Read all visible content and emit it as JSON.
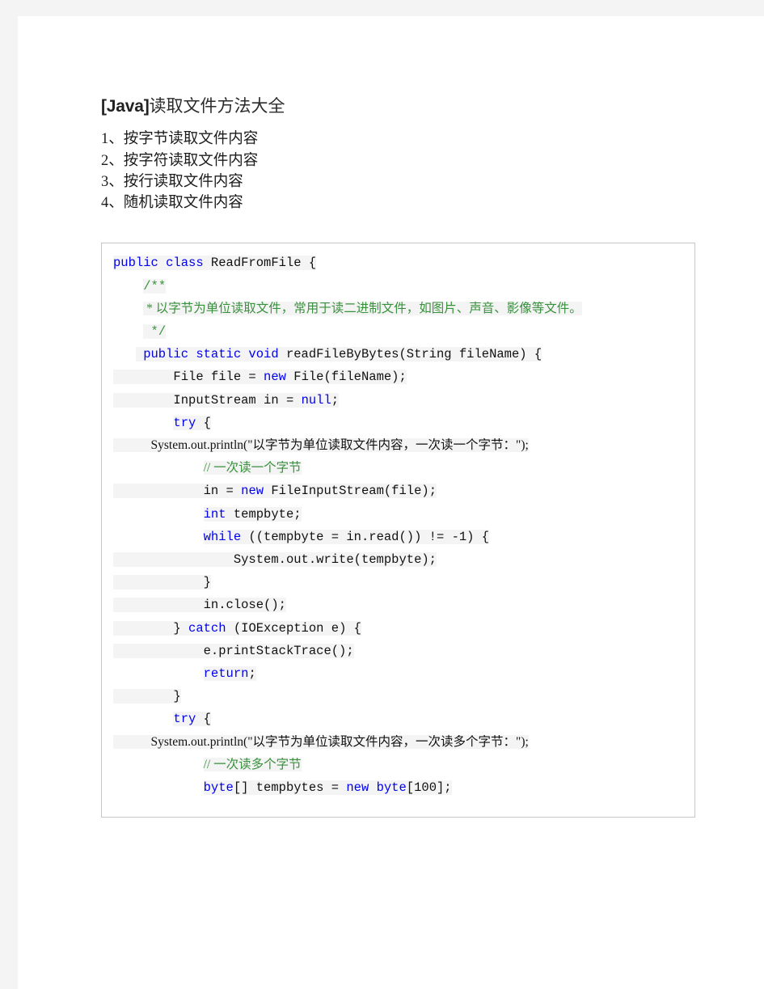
{
  "document": {
    "title": {
      "latin": "[Java]",
      "cjk": "读取文件方法大全"
    },
    "intro_items": [
      "1、按字节读取文件内容",
      "2、按字符读取文件内容",
      "3、按行读取文件内容",
      "4、随机读取文件内容"
    ]
  },
  "colors": {
    "page_background": "#f4f4f4",
    "sheet": "#ffffff",
    "code_border": "#c6c6c6",
    "code_highlight": "#f4f4f4",
    "keyword": "#0000ee",
    "comment": "#38913c",
    "plain": "#111111",
    "title": "#2b2b2b"
  },
  "code_block": {
    "language": "java",
    "lines": [
      [
        {
          "t": "public class ",
          "c": "kw"
        },
        {
          "t": "ReadFromFile {",
          "c": "txt"
        }
      ],
      [
        {
          "t": "    ",
          "c": "plain"
        },
        {
          "t": "/**",
          "c": "cmt"
        }
      ],
      [
        {
          "t": "    ",
          "c": "plain"
        },
        {
          "t": " * 以字节为单位读取文件，常用于读二进制文件，如图片、声音、影像等文件。",
          "c": "cmt"
        }
      ],
      [
        {
          "t": "    ",
          "c": "plain"
        },
        {
          "t": " */",
          "c": "cmt"
        }
      ],
      [
        {
          "t": "   ",
          "c": "plain"
        },
        {
          "t": " public static void ",
          "c": "kw"
        },
        {
          "t": "readFileByBytes(String fileName) {",
          "c": "txt"
        }
      ],
      [
        {
          "t": "        File file = ",
          "c": "txt"
        },
        {
          "t": "new ",
          "c": "kw"
        },
        {
          "t": "File(fileName);",
          "c": "txt"
        }
      ],
      [
        {
          "t": "        InputStream in = ",
          "c": "txt"
        },
        {
          "t": "null",
          "c": "kw"
        },
        {
          "t": ";",
          "c": "txt"
        }
      ],
      [
        {
          "t": "        ",
          "c": "plain"
        },
        {
          "t": "try ",
          "c": "kw"
        },
        {
          "t": "{",
          "c": "txt"
        }
      ],
      [
        {
          "t": "            System.out.println(\"以字节为单位读取文件内容，一次读一个字节：\");",
          "c": "txt"
        }
      ],
      [
        {
          "t": "            ",
          "c": "plain"
        },
        {
          "t": "// 一次读一个字节",
          "c": "cmt"
        }
      ],
      [
        {
          "t": "            in = ",
          "c": "txt"
        },
        {
          "t": "new ",
          "c": "kw"
        },
        {
          "t": "FileInputStream(file);",
          "c": "txt"
        }
      ],
      [
        {
          "t": "            ",
          "c": "plain"
        },
        {
          "t": "int ",
          "c": "kw"
        },
        {
          "t": "tempbyte;",
          "c": "txt"
        }
      ],
      [
        {
          "t": "            ",
          "c": "plain"
        },
        {
          "t": "while ",
          "c": "kw"
        },
        {
          "t": "((tempbyte = in.read()) != -1) {",
          "c": "txt"
        }
      ],
      [
        {
          "t": "                System.out.write(tempbyte);",
          "c": "txt"
        }
      ],
      [
        {
          "t": "            }",
          "c": "txt"
        }
      ],
      [
        {
          "t": "            in.close();",
          "c": "txt"
        }
      ],
      [
        {
          "t": "        } ",
          "c": "txt"
        },
        {
          "t": "catch ",
          "c": "kw"
        },
        {
          "t": "(IOException e) {",
          "c": "txt"
        }
      ],
      [
        {
          "t": "            e.printStackTrace();",
          "c": "txt"
        }
      ],
      [
        {
          "t": "            ",
          "c": "plain"
        },
        {
          "t": "return",
          "c": "kw"
        },
        {
          "t": ";",
          "c": "txt"
        }
      ],
      [
        {
          "t": "        }",
          "c": "txt"
        }
      ],
      [
        {
          "t": "        ",
          "c": "plain"
        },
        {
          "t": "try ",
          "c": "kw"
        },
        {
          "t": "{",
          "c": "txt"
        }
      ],
      [
        {
          "t": "            System.out.println(\"以字节为单位读取文件内容，一次读多个字节：\");",
          "c": "txt"
        }
      ],
      [
        {
          "t": "            ",
          "c": "plain"
        },
        {
          "t": "// 一次读多个字节",
          "c": "cmt"
        }
      ],
      [
        {
          "t": "            ",
          "c": "plain"
        },
        {
          "t": "byte",
          "c": "kw"
        },
        {
          "t": "[] tempbytes = ",
          "c": "txt"
        },
        {
          "t": "new byte",
          "c": "kw"
        },
        {
          "t": "[100];",
          "c": "txt"
        }
      ]
    ]
  }
}
